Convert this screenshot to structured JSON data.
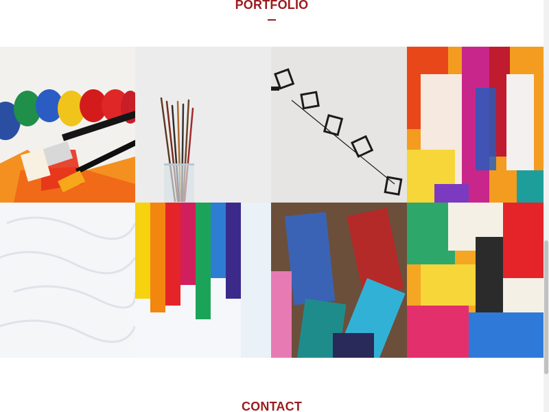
{
  "portfolio": {
    "title": "PORTFOLIO"
  },
  "contact": {
    "title": "CONTACT"
  },
  "colors": {
    "accent": "#9b1b1e",
    "background": "#ffffff"
  },
  "tiles": [
    {
      "subject": "paint tubes and brushes on orange canvas"
    },
    {
      "subject": "paint brushes in glass jar"
    },
    {
      "subject": "floating chairs"
    },
    {
      "subject": "colorful abstract painting"
    },
    {
      "subject": "white textured paint"
    },
    {
      "subject": "rainbow paint strokes"
    },
    {
      "subject": "worn colorful paint brushes"
    },
    {
      "subject": "abstract painting with dripping colors"
    }
  ]
}
